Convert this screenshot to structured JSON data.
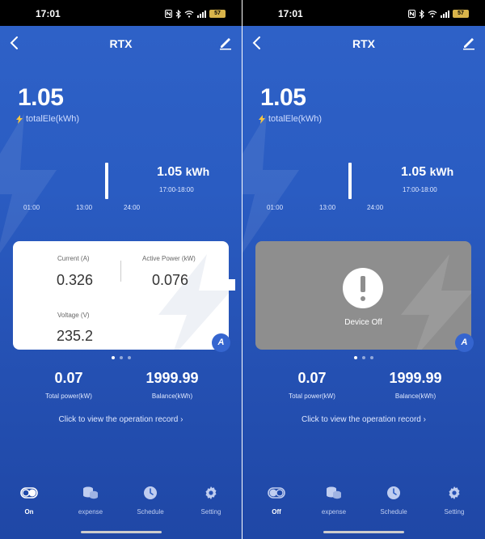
{
  "status_bar": {
    "time": "17:01",
    "battery": "57"
  },
  "screens": [
    {
      "title": "RTX",
      "total": {
        "value": "1.05",
        "label": "totalEle(kWh)"
      },
      "chart": {
        "value": "1.05",
        "unit": "kWh",
        "range": "17:00-18:00",
        "ticks": [
          "01:00",
          "13:00",
          "24:00"
        ]
      },
      "card": {
        "current_label": "Current (A)",
        "current_value": "0.326",
        "power_label": "Active Power (kW)",
        "power_value": "0.076",
        "voltage_label": "Voltage (V)",
        "voltage_value": "235.2",
        "badge": "A"
      },
      "stats": {
        "total_power_value": "0.07",
        "total_power_label": "Total power(kW)",
        "balance_value": "1999.99",
        "balance_label": "Balance(kWh)"
      },
      "record_link": "Click to view the operation record  ›",
      "tabs": [
        "On",
        "expense",
        "Schedule",
        "Setting"
      ]
    },
    {
      "title": "RTX",
      "total": {
        "value": "1.05",
        "label": "totalEle(kWh)"
      },
      "chart": {
        "value": "1.05",
        "unit": "kWh",
        "range": "17:00-18:00",
        "ticks": [
          "01:00",
          "13:00",
          "24:00"
        ]
      },
      "card": {
        "status": "Device Off",
        "badge": "A"
      },
      "stats": {
        "total_power_value": "0.07",
        "total_power_label": "Total power(kW)",
        "balance_value": "1999.99",
        "balance_label": "Balance(kWh)"
      },
      "record_link": "Click to view the operation record  ›",
      "tabs": [
        "Off",
        "expense",
        "Schedule",
        "Setting"
      ]
    }
  ],
  "colors": {
    "primary_blue": "#2f62c8",
    "badge_blue": "#3565cf",
    "card_off_gray": "#8e8e8e"
  },
  "icons": [
    "back-arrow-icon",
    "edit-pencil-icon",
    "bolt-icon",
    "toggle-icon",
    "coins-icon",
    "clock-icon",
    "gear-icon",
    "alert-icon",
    "nfc-icon",
    "bluetooth-icon",
    "wifi-icon",
    "signal-icon",
    "battery-icon"
  ]
}
